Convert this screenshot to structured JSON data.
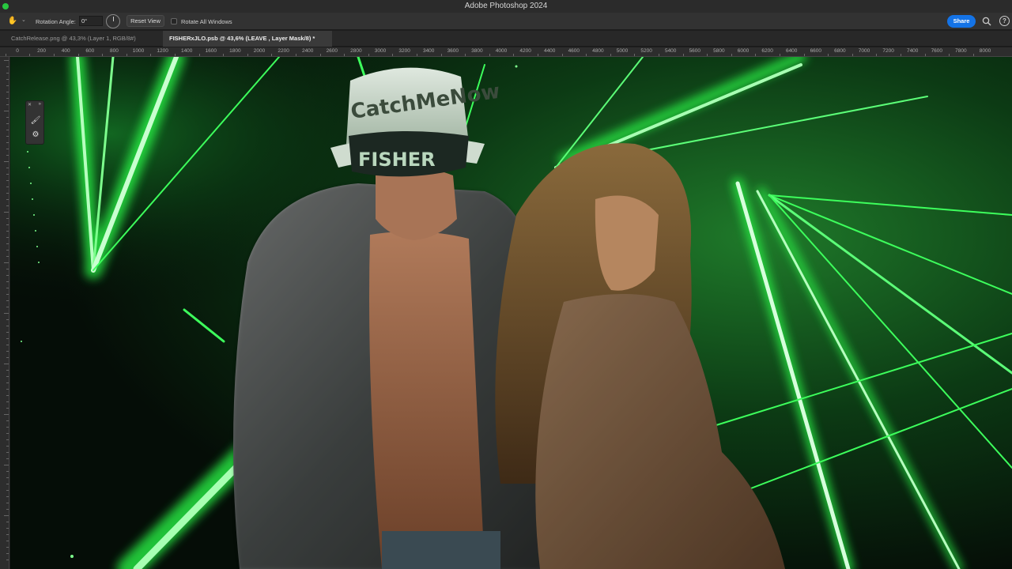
{
  "window": {
    "title": "Adobe Photoshop 2024"
  },
  "options_bar": {
    "tool_icon": "rotate-view-icon",
    "rotation_label": "Rotation Angle:",
    "rotation_value": "0°",
    "reset_view": "Reset View",
    "rotate_all_windows": "Rotate All Windows",
    "rotate_all_checked": false,
    "share": "Share",
    "share_color": "#1473e6"
  },
  "tabs": [
    {
      "label": "CatchRelease.png @ 43,3% (Layer 1, RGB/8#)",
      "active": false
    },
    {
      "label": "FISHERxJLO.psb @ 43,6% (LEAVE , Layer Mask/8) *",
      "active": true
    }
  ],
  "ruler": {
    "ticks": [
      "0",
      "200",
      "400",
      "600",
      "800",
      "1000",
      "1200",
      "1400",
      "1600",
      "1800",
      "2000",
      "2200",
      "2400",
      "2600",
      "2800",
      "3000",
      "3200",
      "3400",
      "3600",
      "3800",
      "4000",
      "4200",
      "4400",
      "4600",
      "4800",
      "5000",
      "5200",
      "5400",
      "5600",
      "5800",
      "6000",
      "6200",
      "6400",
      "6600",
      "6800",
      "7000",
      "7200",
      "7400",
      "7600",
      "7800",
      "8000"
    ]
  },
  "canvas": {
    "hat_text": "CatchMeNow",
    "mask_text": "FISHER",
    "laser_color": "#2bff4a"
  }
}
